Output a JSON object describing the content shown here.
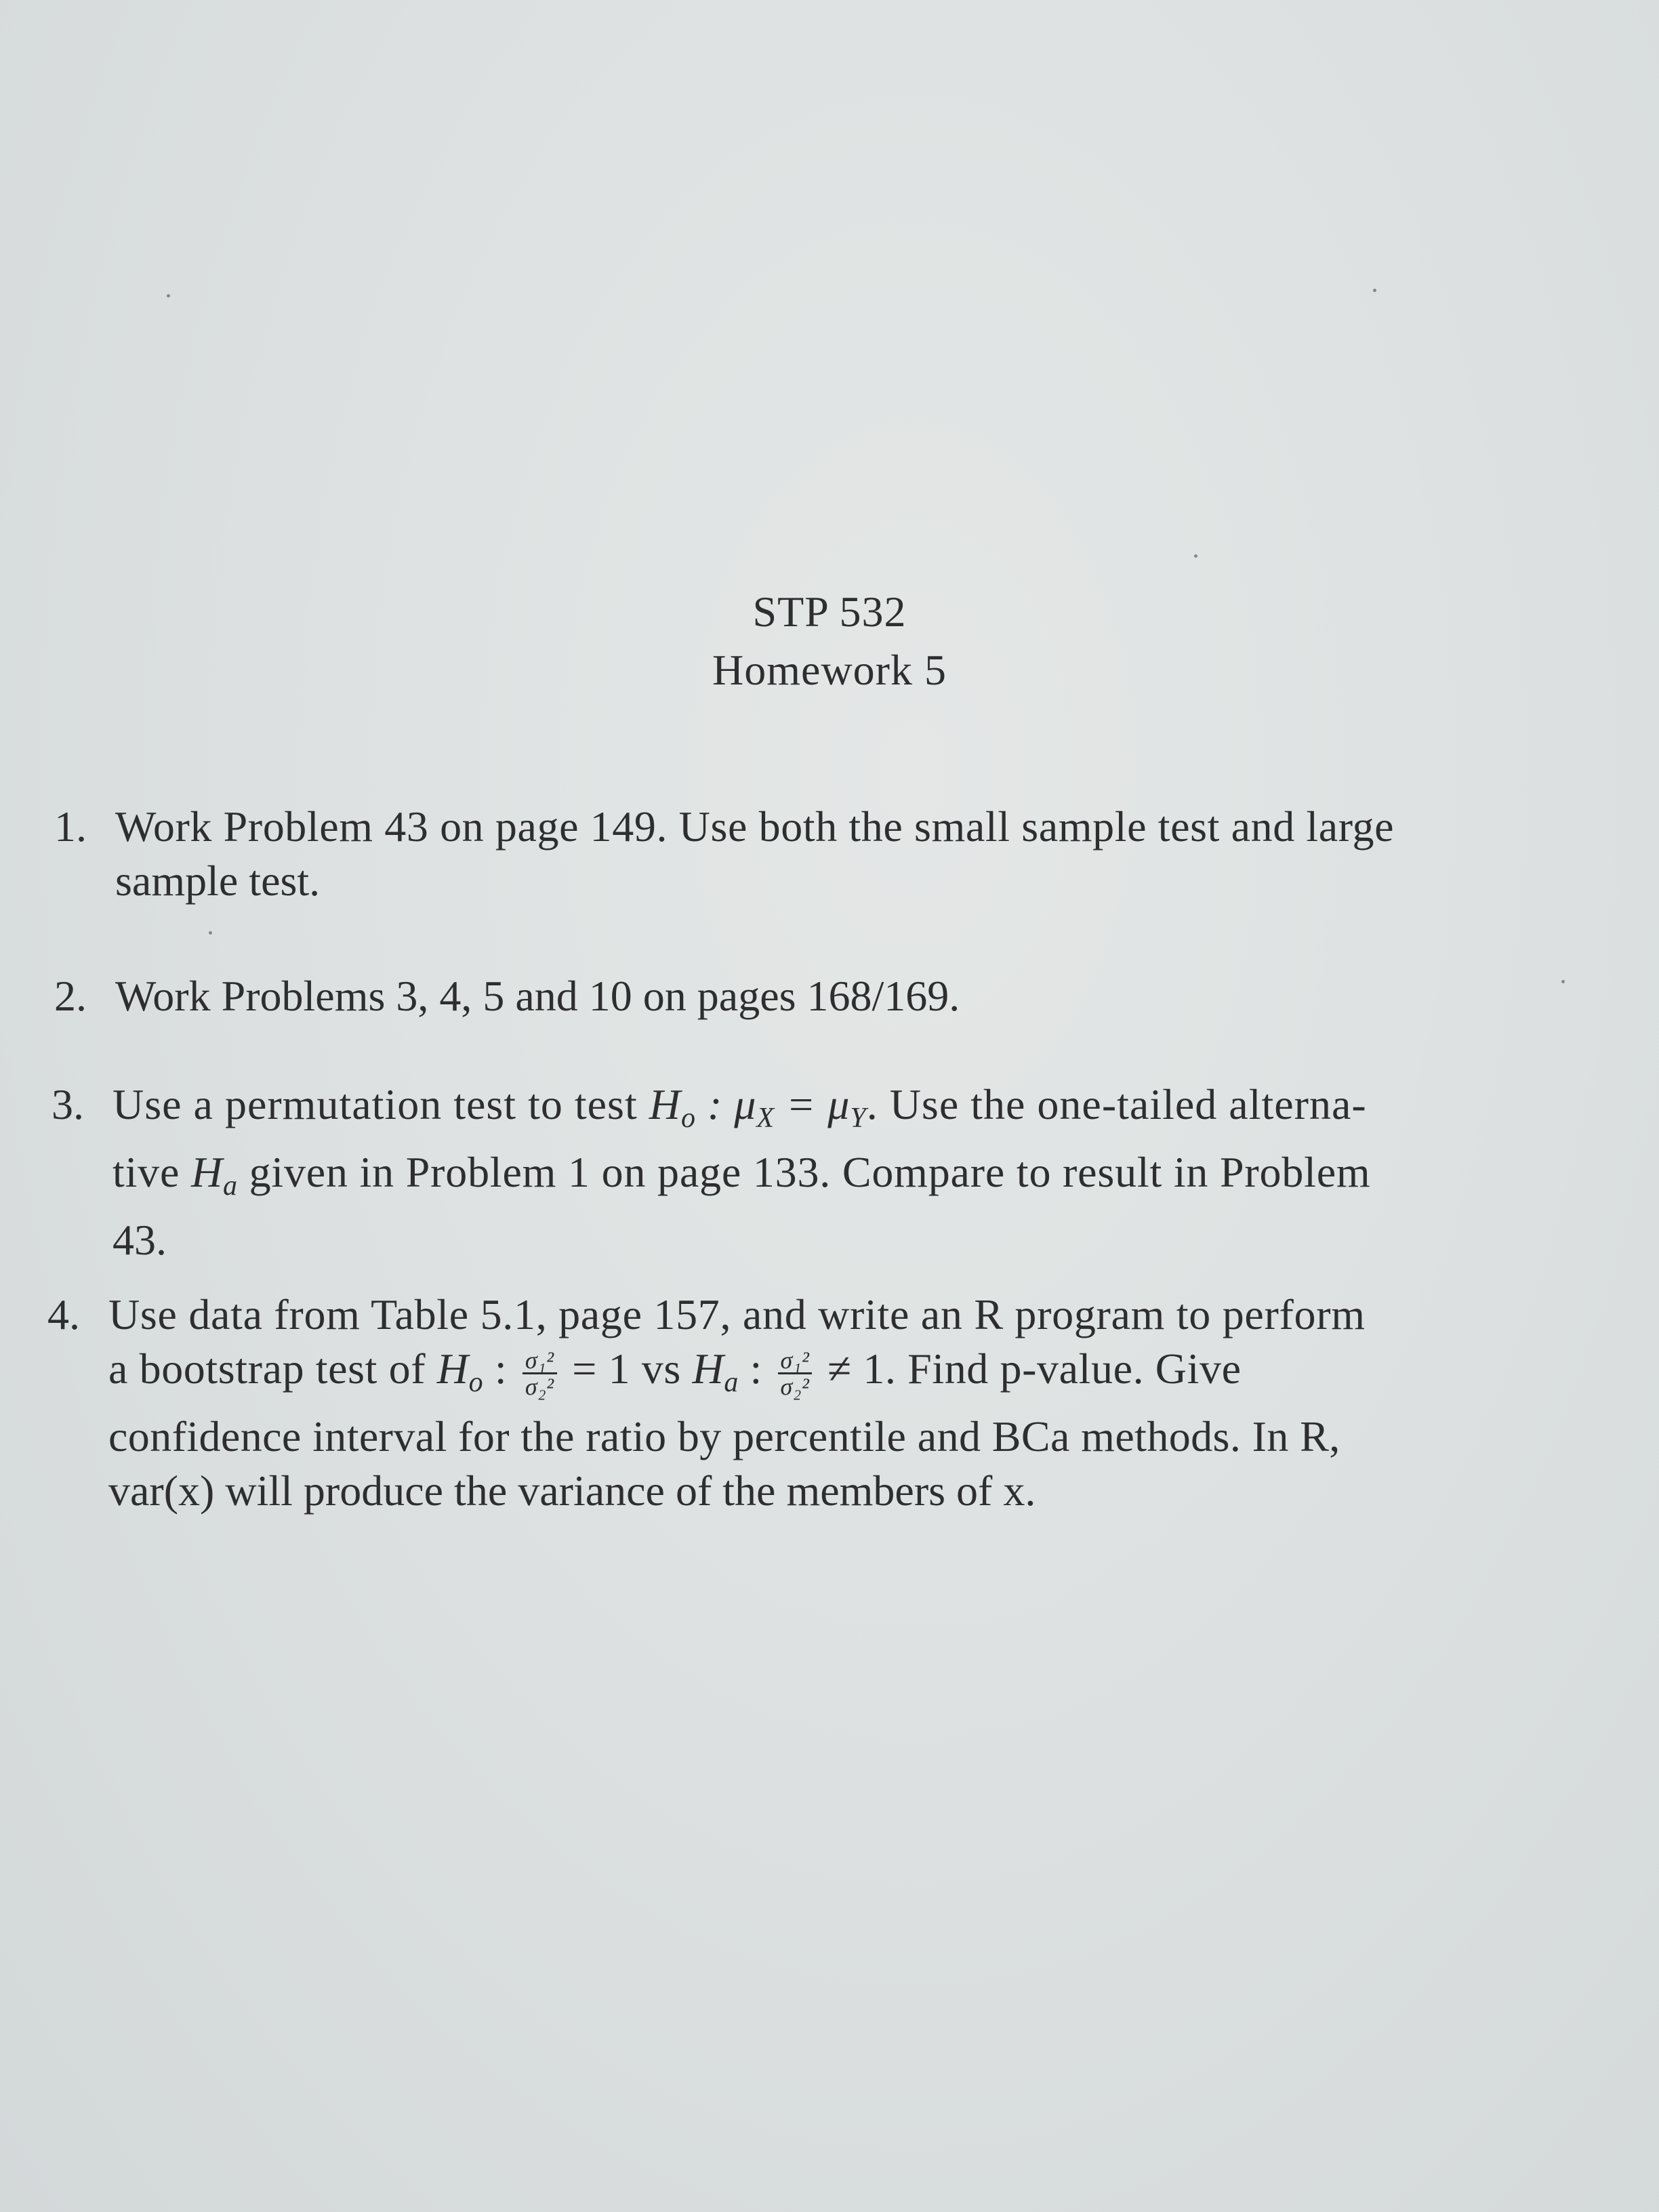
{
  "header": {
    "course": "STP 532",
    "assignment": "Homework 5"
  },
  "problems": [
    {
      "number": "1.",
      "lines": [
        "Work Problem 43 on page 149. Use both the small sample test and large",
        "sample test."
      ]
    },
    {
      "number": "2.",
      "lines": [
        "Work Problems 3, 4, 5 and 10 on pages 168/169."
      ]
    },
    {
      "number": "3.",
      "line1_pre": "Use a permutation test to test ",
      "line1_hyp": "H",
      "line1_hyp_sub": "o",
      "line1_mid": " : μ",
      "line1_x_sub": "X",
      "line1_eq": " = μ",
      "line1_y_sub": "Y",
      "line1_post": ". Use the one-tailed alterna-",
      "line2_pre": "tive ",
      "line2_hyp": "H",
      "line2_hyp_sub": "a",
      "line2_post": " given in Problem 1 on page 133. Compare to result in Problem",
      "line3": "43."
    },
    {
      "number": "4.",
      "line1": "Use data from Table 5.1, page 157, and write an R program to perform",
      "line2_pre": "a bootstrap test of ",
      "line2_h0": "H",
      "line2_h0_sub": "o",
      "line2_colon": " : ",
      "frac_top": "σ₁²",
      "frac_bot": "σ₂²",
      "line2_eq": " = 1 vs ",
      "line2_ha": "H",
      "line2_ha_sub": "a",
      "line2_colon2": " : ",
      "line2_neq": " ≠ 1. Find p-value. Give",
      "line3": "confidence interval for the ratio by percentile and BCa methods. In R,",
      "line4": "var(x) will produce the variance of the members of x."
    }
  ]
}
